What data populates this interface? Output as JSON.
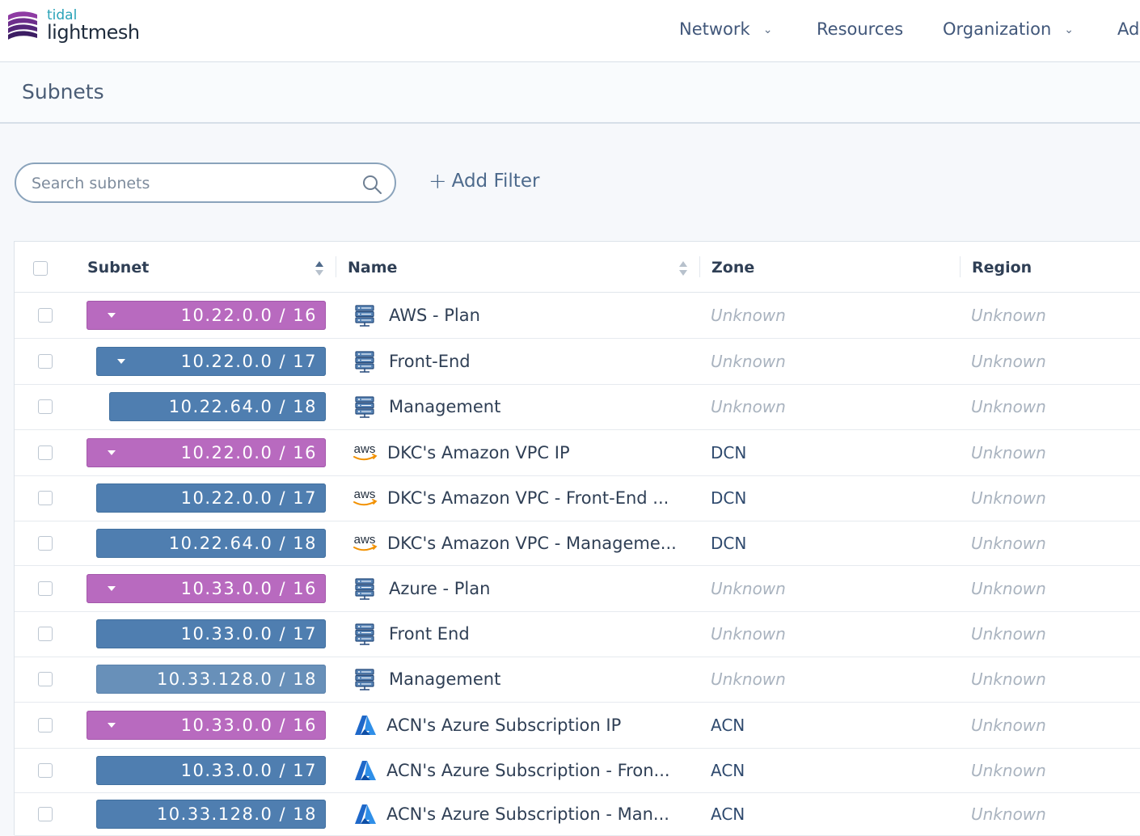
{
  "brand": {
    "small": "tidal",
    "big": "lightmesh"
  },
  "nav": {
    "items": [
      {
        "label": "Network",
        "has_dropdown": true
      },
      {
        "label": "Resources",
        "has_dropdown": false
      },
      {
        "label": "Organization",
        "has_dropdown": true
      },
      {
        "label": "Ad",
        "has_dropdown": false
      }
    ]
  },
  "page": {
    "title": "Subnets"
  },
  "search": {
    "placeholder": "Search subnets",
    "value": ""
  },
  "filter": {
    "add_label": "Add Filter"
  },
  "table": {
    "columns": [
      "Subnet",
      "Name",
      "Zone",
      "Region"
    ],
    "rows": [
      {
        "subnet": "10.22.0.0 / 16",
        "color": "purple",
        "expandable": true,
        "icon": "server-stack-icon",
        "name": "AWS - Plan",
        "zone": "Unknown",
        "region": "Unknown"
      },
      {
        "subnet": "10.22.0.0 / 17",
        "color": "blue",
        "expandable": true,
        "icon": "server-stack-icon",
        "name": "Front-End",
        "zone": "Unknown",
        "region": "Unknown"
      },
      {
        "subnet": "10.22.64.0 / 18",
        "color": "blue",
        "expandable": false,
        "icon": "server-stack-icon",
        "name": "Management",
        "zone": "Unknown",
        "region": "Unknown"
      },
      {
        "subnet": "10.22.0.0 / 16",
        "color": "purple",
        "expandable": true,
        "icon": "aws-logo-icon",
        "name": "DKC's Amazon VPC IP",
        "zone": "DCN",
        "region": "Unknown"
      },
      {
        "subnet": "10.22.0.0 / 17",
        "color": "blue",
        "expandable": false,
        "icon": "aws-logo-icon",
        "name": "DKC's Amazon VPC - Front-End ...",
        "zone": "DCN",
        "region": "Unknown"
      },
      {
        "subnet": "10.22.64.0 / 18",
        "color": "blue",
        "expandable": false,
        "icon": "aws-logo-icon",
        "name": "DKC's Amazon VPC - Manageme...",
        "zone": "DCN",
        "region": "Unknown"
      },
      {
        "subnet": "10.33.0.0 / 16",
        "color": "purple",
        "expandable": true,
        "icon": "server-stack-icon",
        "name": "Azure - Plan",
        "zone": "Unknown",
        "region": "Unknown"
      },
      {
        "subnet": "10.33.0.0 / 17",
        "color": "blue",
        "expandable": false,
        "icon": "server-stack-icon",
        "name": "Front End",
        "zone": "Unknown",
        "region": "Unknown"
      },
      {
        "subnet": "10.33.128.0 / 18",
        "color": "blue-light",
        "expandable": false,
        "icon": "server-stack-icon",
        "name": "Management",
        "zone": "Unknown",
        "region": "Unknown"
      },
      {
        "subnet": "10.33.0.0 / 16",
        "color": "purple",
        "expandable": true,
        "icon": "azure-logo-icon",
        "name": "ACN's Azure Subscription IP",
        "zone": "ACN",
        "region": "Unknown"
      },
      {
        "subnet": "10.33.0.0 / 17",
        "color": "blue",
        "expandable": false,
        "icon": "azure-logo-icon",
        "name": "ACN's Azure Subscription - Fron...",
        "zone": "ACN",
        "region": "Unknown"
      },
      {
        "subnet": "10.33.128.0 / 18",
        "color": "blue",
        "expandable": false,
        "icon": "azure-logo-icon",
        "name": "ACN's Azure Subscription - Man...",
        "zone": "ACN",
        "region": "Unknown"
      }
    ]
  }
}
